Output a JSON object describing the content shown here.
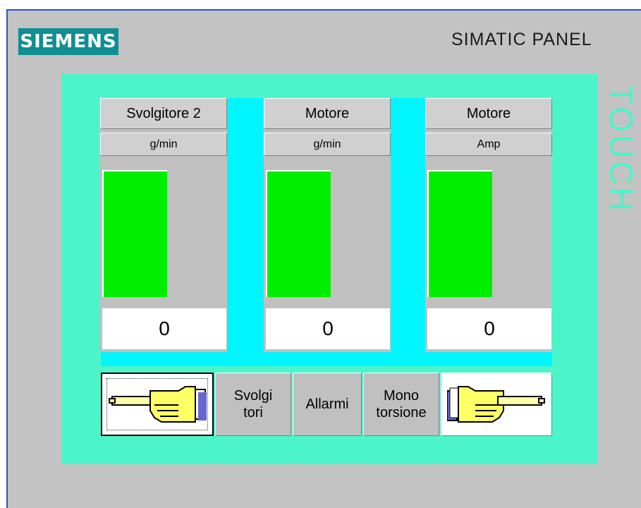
{
  "header": {
    "brand": "SIEMENS",
    "panel_name": "SIMATIC PANEL",
    "side_label": "TOUCH"
  },
  "gauges": [
    {
      "title": "Svolgitore 2",
      "unit": "g/min",
      "value": "0",
      "fill_fraction": 1.0
    },
    {
      "title": "Motore",
      "unit": "g/min",
      "value": "0",
      "fill_fraction": 1.0
    },
    {
      "title": "Motore",
      "unit": "Amp",
      "value": "0",
      "fill_fraction": 1.0
    }
  ],
  "nav": {
    "prev_icon": "pointing-hand-left-icon",
    "next_icon": "pointing-hand-right-icon",
    "svolgitori_line1": "Svolgi",
    "svolgitori_line2": "tori",
    "allarmi": "Allarmi",
    "mono_line1": "Mono",
    "mono_line2": "torsione"
  },
  "colors": {
    "brand": "#0f8f91",
    "screen_bg": "#4cf5c9",
    "bar_fill": "#00ee00",
    "cyan": "#00f5ff"
  }
}
